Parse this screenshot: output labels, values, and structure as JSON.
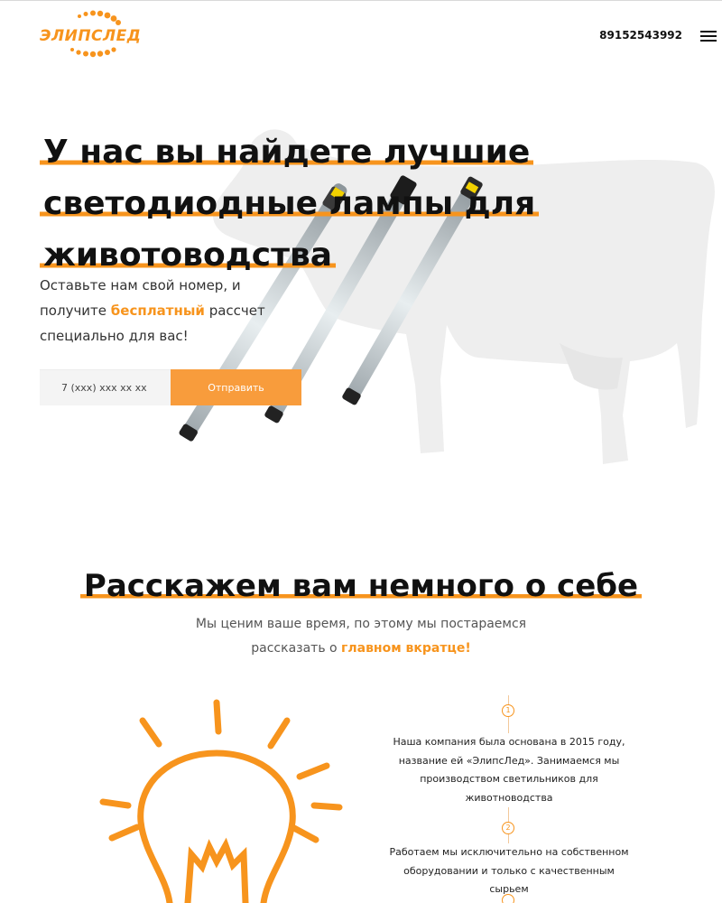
{
  "header": {
    "logo_text": "ЭЛИПСЛЕД",
    "phone": "89152543992",
    "menu_icon": "hamburger-icon"
  },
  "hero": {
    "title_line1": "У нас вы найдете лучшие",
    "title_line2": "светодиодные лампы для",
    "title_line3": "животоводства",
    "sub_part1": "Оставьте нам свой номер, и получите ",
    "sub_accent": "бесплатный",
    "sub_part2": " рассчет специально для вас!",
    "phone_placeholder": "7 (xxx) xxx xx xx",
    "submit_label": "Отправить"
  },
  "about": {
    "title": "Расскажем вам немного о себе",
    "sub_part1": "Мы ценим ваше время, по этому мы постараемся",
    "sub_part2": "рассказать о ",
    "sub_accent": "главном вкратце!",
    "steps": [
      {
        "num": "1",
        "text": "Наша компания была основана в 2015 году, название ей «ЭлипсЛед». Занимаемся мы производством светильников для животноводства"
      },
      {
        "num": "2",
        "text": "Работаем мы исключительно на собственном оборудовании и только с качественным сырьем"
      }
    ]
  },
  "colors": {
    "accent": "#f7941d",
    "button": "#f89c3c",
    "input_bg": "#f4f4f4",
    "text": "#111111"
  }
}
